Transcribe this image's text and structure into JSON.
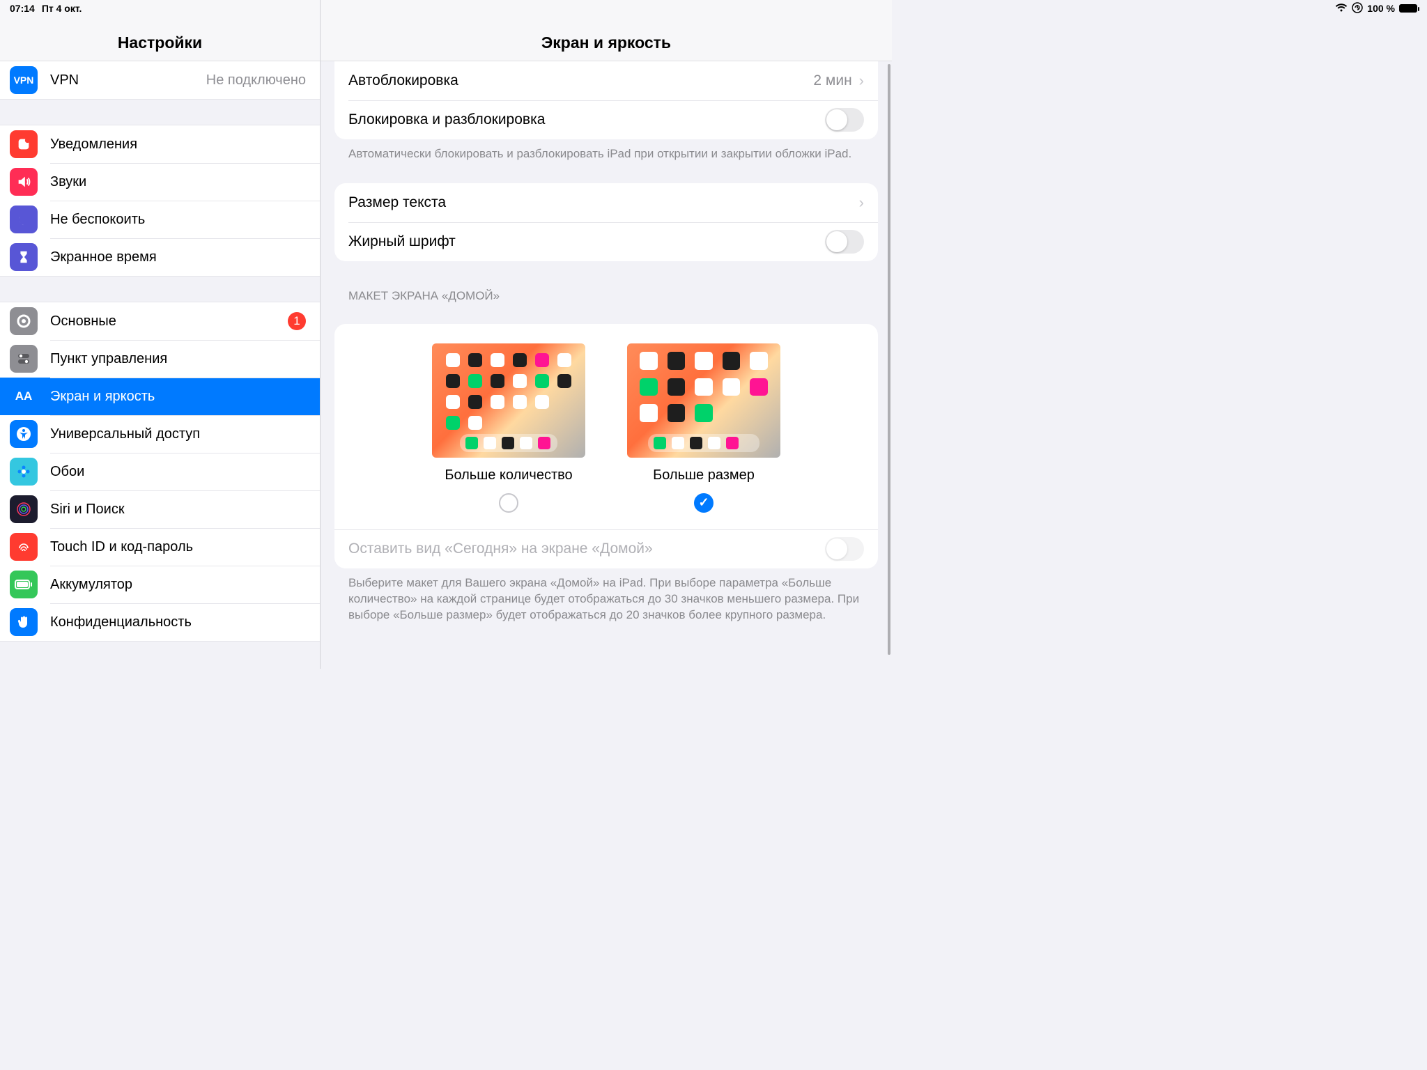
{
  "status": {
    "time": "07:14",
    "date": "Пт 4 окт.",
    "battery": "100 %"
  },
  "sidebar": {
    "title": "Настройки",
    "group0": [
      {
        "label": "VPN",
        "value": "Не подключено",
        "icon": "vpn",
        "bg": "#007aff"
      }
    ],
    "group1": [
      {
        "label": "Уведомления",
        "icon": "bell",
        "bg": "#ff3b30"
      },
      {
        "label": "Звуки",
        "icon": "sound",
        "bg": "#ff2d55"
      },
      {
        "label": "Не беспокоить",
        "icon": "moon",
        "bg": "#5856d6"
      },
      {
        "label": "Экранное время",
        "icon": "hourglass",
        "bg": "#5856d6"
      }
    ],
    "group2": [
      {
        "label": "Основные",
        "icon": "gear",
        "bg": "#8e8e93",
        "badge": "1"
      },
      {
        "label": "Пункт управления",
        "icon": "switches",
        "bg": "#8e8e93"
      },
      {
        "label": "Экран и яркость",
        "icon": "AA",
        "bg": "#007aff",
        "selected": true
      },
      {
        "label": "Универсальный доступ",
        "icon": "access",
        "bg": "#007aff"
      },
      {
        "label": "Обои",
        "icon": "flower",
        "bg": "#34c7e0"
      },
      {
        "label": "Siri и Поиск",
        "icon": "siri",
        "bg": "#1c1c2e"
      },
      {
        "label": "Touch ID и код-пароль",
        "icon": "finger",
        "bg": "#ff3b30"
      },
      {
        "label": "Аккумулятор",
        "icon": "battery",
        "bg": "#34c759"
      },
      {
        "label": "Конфиденциальность",
        "icon": "hand",
        "bg": "#007aff"
      }
    ]
  },
  "detail": {
    "title": "Экран и яркость",
    "autolock": {
      "label": "Автоблокировка",
      "value": "2 мин"
    },
    "lockunlock": {
      "label": "Блокировка и разблокировка"
    },
    "lockFooter": "Автоматически блокировать и разблокировать iPad при открытии и закрытии обложки iPad.",
    "textSize": {
      "label": "Размер текста"
    },
    "bold": {
      "label": "Жирный шрифт"
    },
    "homeHeader": "МАКЕТ ЭКРАНА «ДОМОЙ»",
    "optMore": "Больше количество",
    "optLarger": "Больше размер",
    "todayLabel": "Оставить вид «Сегодня» на экране «Домой»",
    "homeFooter": "Выберите макет для Вашего экрана «Домой» на iPad. При выборе параметра «Больше количество» на каждой странице будет отображаться до 30 значков меньшего размера. При выборе «Больше размер» будет отображаться до 20 значков более крупного размера."
  }
}
